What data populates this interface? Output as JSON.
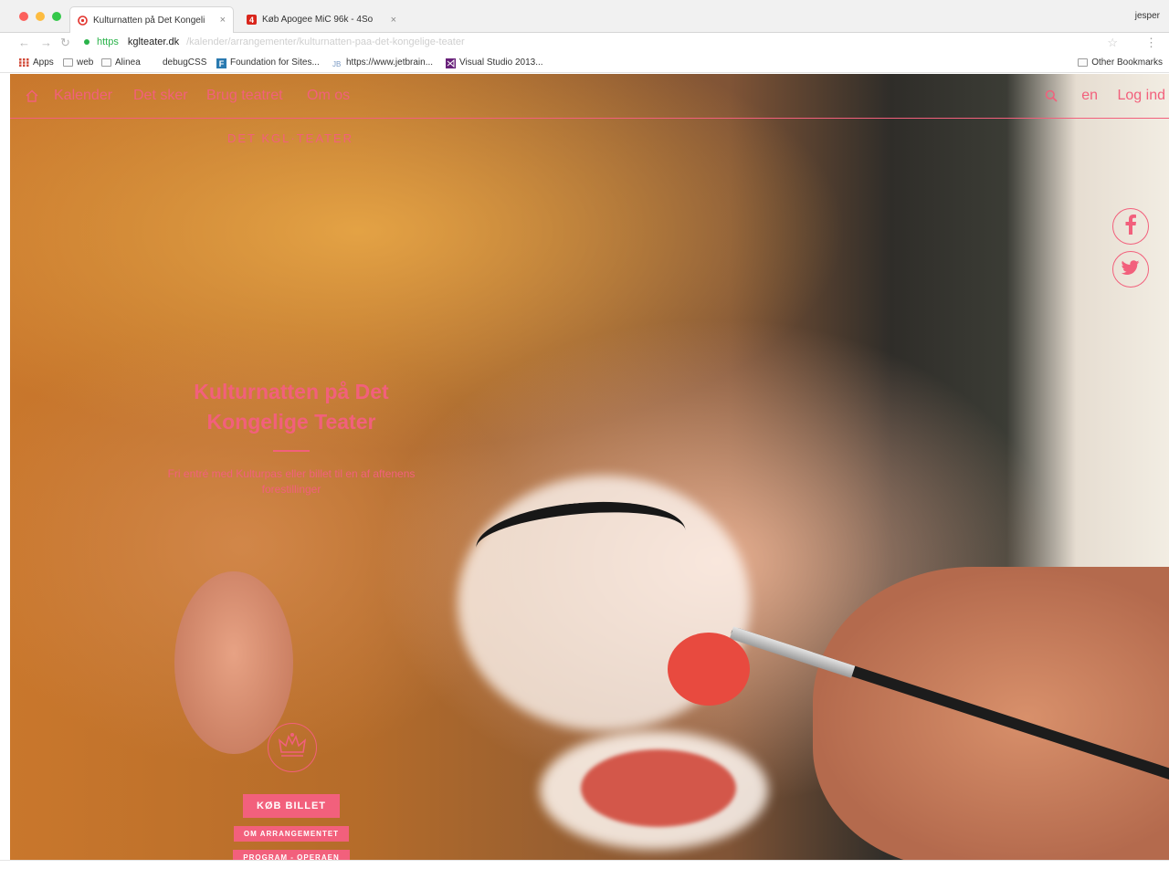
{
  "browser": {
    "tabs": [
      {
        "title": "Kulturnatten på Det Kongeli",
        "close": "×"
      },
      {
        "title": "Køb Apogee MiC 96k - 4So",
        "close": "×"
      }
    ],
    "profile": "jesper",
    "address": {
      "scheme": "https",
      "host": "kglteater.dk",
      "rest": "/kalender/arrangementer/kulturnatten-paa-det-kongelige-teater"
    },
    "bookmarks": [
      {
        "label": "Apps",
        "icon": "apps-grid-icon"
      },
      {
        "label": "web",
        "icon": "folder-icon"
      },
      {
        "label": "Alinea",
        "icon": "folder-icon"
      },
      {
        "label": "debugCSS",
        "icon": "bookmark-icon"
      },
      {
        "label": "Foundation for Sites...",
        "icon": "foundation-icon"
      },
      {
        "label": "https://www.jetbrain...",
        "icon": "jetbrains-icon"
      },
      {
        "label": "Visual Studio 2013...",
        "icon": "visual-studio-icon"
      }
    ],
    "other_bookmarks": "Other Bookmarks"
  },
  "site": {
    "nav": [
      {
        "label": "Kalender"
      },
      {
        "label": "Det sker"
      },
      {
        "label": "Brug teatret"
      },
      {
        "label": "Om os"
      }
    ],
    "lang": "en",
    "login": "Log ind",
    "logo": "DET KGL·TEATER",
    "hero": {
      "title": "Kulturnatten på Det Kongelige Teater",
      "subtitle": "Fri entré med Kulturpas eller billet til en af aftenens forestillinger"
    },
    "buttons": {
      "buy": "KØB BILLET",
      "about": "OM ARRANGEMENTET",
      "program": "PROGRAM - OPERAEN"
    },
    "colors": {
      "accent": "#f2607c"
    }
  }
}
